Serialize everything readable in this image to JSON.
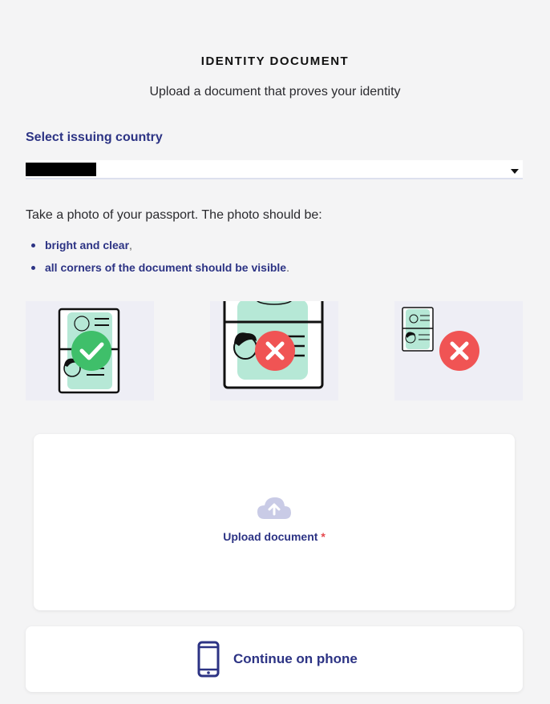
{
  "header": {
    "title": "IDENTITY DOCUMENT",
    "subtitle": "Upload a document that proves your identity"
  },
  "country": {
    "label": "Select issuing country",
    "selected_value": ""
  },
  "instructions": {
    "text": "Take a photo of your passport. The photo should be:",
    "requirements": [
      {
        "text": "bright and clear",
        "punct": ","
      },
      {
        "text": "all corners of the document should be visible",
        "punct": "."
      }
    ]
  },
  "examples": [
    {
      "status": "correct",
      "icon": "check-icon"
    },
    {
      "status": "incorrect",
      "icon": "cross-icon"
    },
    {
      "status": "incorrect",
      "icon": "cross-icon"
    }
  ],
  "upload": {
    "label": "Upload document",
    "required_mark": "*",
    "icon": "cloud-upload-icon"
  },
  "phone": {
    "label": "Continue on phone",
    "icon": "phone-icon"
  },
  "colors": {
    "accent": "#2c3384",
    "success": "#3fbf6a",
    "error": "#f05454",
    "document_fill": "#b6e8d6",
    "background": "#f4f4f5"
  }
}
